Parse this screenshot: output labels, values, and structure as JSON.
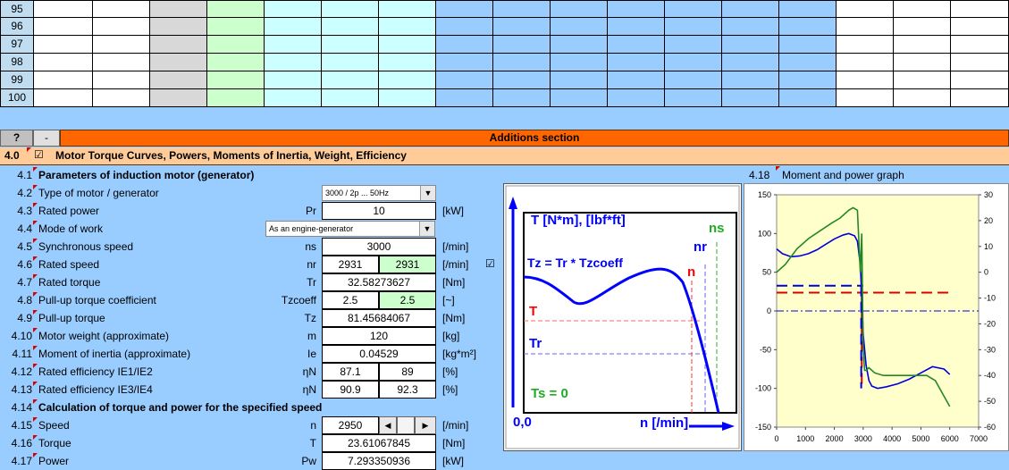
{
  "grid": {
    "row_numbers": [
      "95",
      "96",
      "97",
      "98",
      "99",
      "100"
    ]
  },
  "colors": {
    "accent_orange": "#ff6600",
    "header_band": "#ffcc99",
    "panel_bg": "#99ccff",
    "graph_bg": "#ffffcc"
  },
  "toolbar": {
    "help_label": "?",
    "collapse_label": "-",
    "section_title": "Additions section"
  },
  "section": {
    "number": "4.0",
    "checkbox_mark": "☑",
    "title": "Motor Torque Curves, Powers, Moments of Inertia, Weight, Efficiency"
  },
  "rows": [
    {
      "num": "4.1",
      "label": "Parameters of induction motor (generator)",
      "bold": true
    },
    {
      "num": "4.2",
      "label": "Type of motor / generator",
      "select": "3000 / 2p ... 50Hz"
    },
    {
      "num": "4.3",
      "label": "Rated power",
      "sym": "Pr",
      "v1": "10",
      "unit": "[kW]"
    },
    {
      "num": "4.4",
      "label": "Mode of work",
      "select": "As an engine-generator"
    },
    {
      "num": "4.5",
      "label": "Synchronous speed",
      "sym": "ns",
      "v1": "3000",
      "unit": "[/min]"
    },
    {
      "num": "4.6",
      "label": "Rated speed",
      "sym": "nr",
      "v1": "2931",
      "v2": "2931",
      "unit": "[/min]",
      "check": "☑"
    },
    {
      "num": "4.7",
      "label": "Rated torque",
      "sym": "Tr",
      "v1": "32.58273627",
      "unit": "[Nm]"
    },
    {
      "num": "4.8",
      "label": "Pull-up torque coefficient",
      "sym": "Tzcoeff",
      "v1": "2.5",
      "v2": "2.5",
      "unit": "[~]"
    },
    {
      "num": "4.9",
      "label": "Pull-up torque",
      "sym": "Tz",
      "v1": "81.45684067",
      "unit": "[Nm]"
    },
    {
      "num": "4.10",
      "label": "Motor weight (approximate)",
      "sym": "m",
      "v1": "120",
      "unit": "[kg]"
    },
    {
      "num": "4.11",
      "label": "Moment of inertia (approximate)",
      "sym": "Ie",
      "v1": "0.04529",
      "unit": "[kg*m²]"
    },
    {
      "num": "4.12",
      "label": "Rated efficiency IE1/IE2",
      "sym": "ηN",
      "v1": "87.1",
      "v3": "89",
      "unit": "[%]"
    },
    {
      "num": "4.13",
      "label": "Rated efficiency IE3/IE4",
      "sym": "ηN",
      "v1": "90.9",
      "v3": "92.3",
      "unit": "[%]"
    },
    {
      "num": "4.14",
      "label": "Calculation of torque and power for the specified speed",
      "bold": true
    },
    {
      "num": "4.15",
      "label": "Speed",
      "sym": "n",
      "v1": "2950",
      "unit": "[/min]",
      "spinner": true
    },
    {
      "num": "4.16",
      "label": "Torque",
      "sym": "T",
      "v1": "23.61067845",
      "unit": "[Nm]"
    },
    {
      "num": "4.17",
      "label": "Power",
      "sym": "Pw",
      "v1": "7.293350936",
      "unit": "[kW]"
    }
  ],
  "diagram": {
    "y_axis_label": "T [N*m], [lbf*ft]",
    "x_axis_label": "n [/min]",
    "origin": "0,0",
    "tz_formula": "Tz = Tr * Tzcoeff",
    "t_label": "T",
    "tr_label": "Tr",
    "ts_label": "Ts = 0",
    "n_label": "n",
    "nr_label": "nr",
    "ns_label": "ns"
  },
  "graph": {
    "number": "4.18",
    "title": "Moment and power graph"
  },
  "chart_data": {
    "type": "line",
    "title": "Moment and power graph",
    "xlabel": "",
    "ylabel": "",
    "xlim": [
      0,
      7000
    ],
    "ylim": [
      -150,
      150
    ],
    "y2lim": [
      -60,
      30
    ],
    "x_ticks": [
      0,
      1000,
      2000,
      3000,
      4000,
      5000,
      6000,
      7000
    ],
    "y_ticks": [
      150,
      100,
      50,
      0,
      -50,
      -100,
      -150
    ],
    "y2_ticks": [
      30,
      20,
      10,
      0,
      -10,
      -20,
      -30,
      -40,
      -50,
      -60
    ],
    "grid": false,
    "series": [
      {
        "color": "#0000dd",
        "axis": "left",
        "x": [
          0,
          200,
          500,
          800,
          1100,
          1400,
          1700,
          2000,
          2300,
          2500,
          2700,
          2800,
          2900,
          2950,
          3000,
          3100,
          3200,
          3300,
          3500,
          3800,
          4200,
          4600,
          5000,
          5400,
          5800,
          6000
        ],
        "y": [
          80,
          74,
          70,
          71,
          74,
          79,
          86,
          93,
          98,
          100,
          97,
          90,
          60,
          20,
          -30,
          -70,
          -90,
          -97,
          -100,
          -98,
          -94,
          -88,
          -80,
          -72,
          -75,
          -82
        ]
      },
      {
        "color": "#228822",
        "axis": "right",
        "x": [
          0,
          300,
          700,
          1100,
          1500,
          1900,
          2200,
          2500,
          2650,
          2800,
          2900,
          2950,
          3000,
          3050,
          3100,
          3200,
          3400,
          3700,
          4000,
          4400,
          4800,
          5200,
          5500,
          5800,
          6000
        ],
        "y": [
          0,
          3,
          9,
          13,
          16,
          19,
          21,
          24,
          25,
          24,
          0,
          15,
          -30,
          -38,
          -38,
          -37,
          -39,
          -40,
          -40,
          -40,
          -40,
          -40,
          -42,
          -48,
          -52
        ]
      }
    ],
    "hlines": [
      {
        "color": "#0000dd",
        "style": "dash",
        "y": 32.6,
        "x_end": 3000
      },
      {
        "color": "#dd0000",
        "style": "dash",
        "y": 23.6,
        "x_end": 6000
      },
      {
        "color": "#0000dd",
        "style": "dashdot",
        "y": 0,
        "x_end": 7000
      }
    ]
  }
}
